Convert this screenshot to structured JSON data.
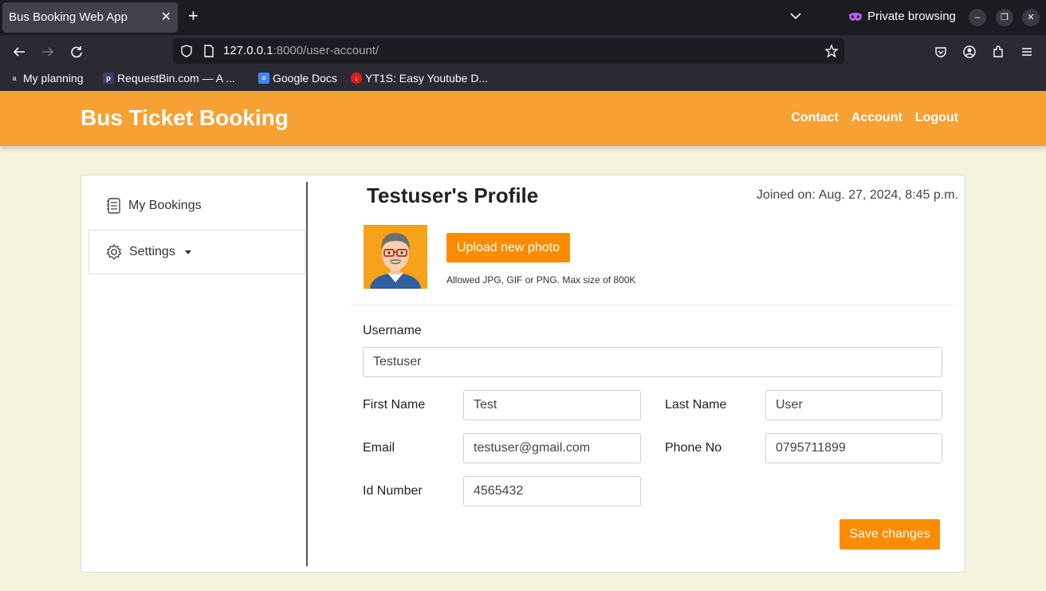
{
  "browser": {
    "tab_title": "Bus Booking Web App",
    "new_tab_label": "+",
    "private_label": "Private browsing",
    "url_host": "127.0.0.1",
    "url_rest": ":8000/user-account/",
    "bookmarks": [
      {
        "label": "My planning",
        "icon": "alx-icon"
      },
      {
        "label": "RequestBin.com — A ...",
        "icon": "p-icon"
      },
      {
        "label": "Google Docs",
        "icon": "docs-icon"
      },
      {
        "label": "YT1S: Easy Youtube D...",
        "icon": "download-icon"
      }
    ]
  },
  "site": {
    "brand": "Bus Ticket Booking",
    "nav": [
      "Contact",
      "Account",
      "Logout"
    ],
    "brand_color": "#f7a034",
    "accent_color": "#fb8c00"
  },
  "sidebar": {
    "bookings_label": "My Bookings",
    "settings_label": "Settings"
  },
  "profile": {
    "title": "Testuser's Profile",
    "joined_label": "Joined on:",
    "joined_value": "Aug. 27, 2024, 8:45 p.m.",
    "upload_label": "Upload new photo",
    "allowed_text": "Allowed JPG, GIF or PNG. Max size of 800K"
  },
  "form": {
    "username_label": "Username",
    "username_value": "Testuser",
    "first_name_label": "First Name",
    "first_name_value": "Test",
    "last_name_label": "Last Name",
    "last_name_value": "User",
    "email_label": "Email",
    "email_value": "testuser@gmail.com",
    "phone_label": "Phone No",
    "phone_value": "0795711899",
    "id_label": "Id Number",
    "id_value": "4565432",
    "save_label": "Save changes"
  }
}
